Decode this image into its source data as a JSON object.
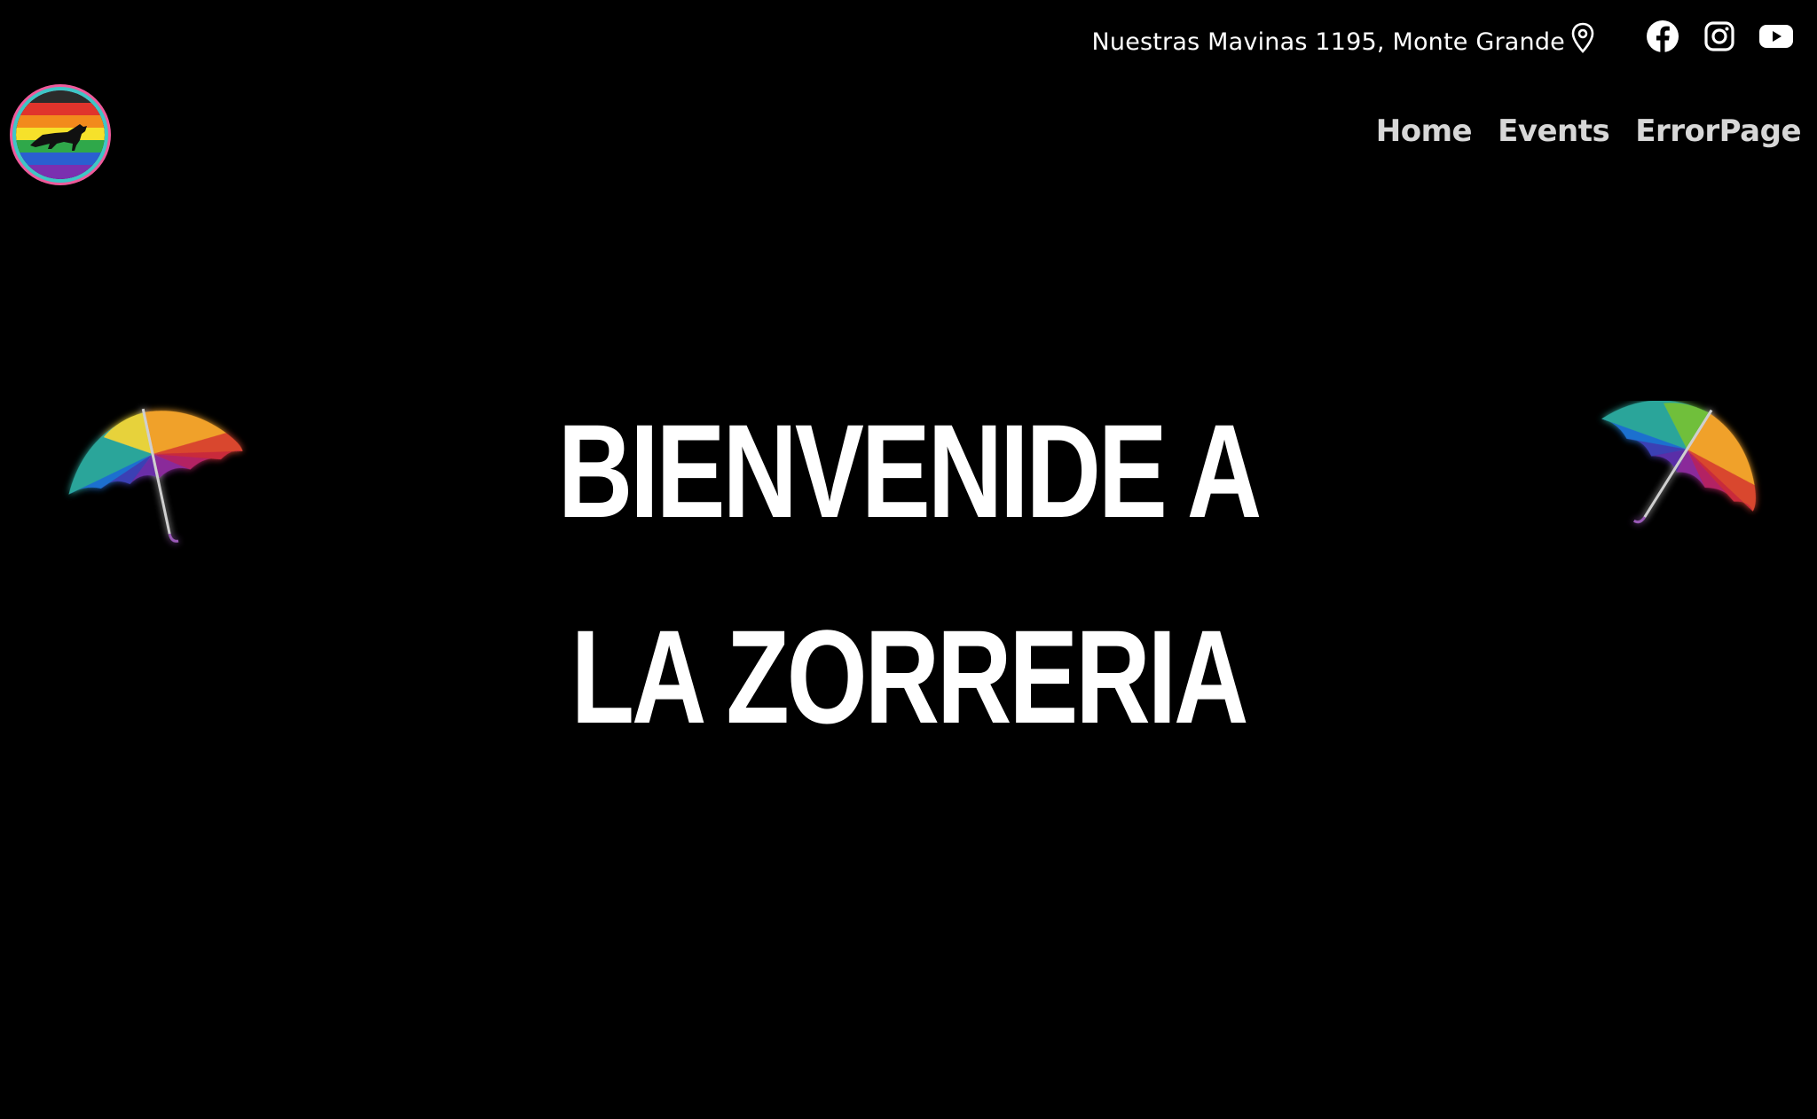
{
  "header": {
    "address": "Nuestras Mavinas 1195, Monte Grande",
    "icons": {
      "location": "location-pin-icon",
      "facebook": "facebook-icon",
      "instagram": "instagram-icon",
      "youtube": "youtube-icon"
    }
  },
  "nav": {
    "items": [
      {
        "label": "Home"
      },
      {
        "label": "Events"
      },
      {
        "label": "ErrorPage"
      }
    ]
  },
  "hero": {
    "line1": "BIENVENIDE A",
    "line2": "LA ZORRERIA"
  },
  "colors": {
    "background": "#000000",
    "text": "#ffffff",
    "nav_text": "#d7d7d7",
    "logo_ring_inner": "#3ec6c6",
    "logo_ring_outer": "#ef5a9b"
  }
}
